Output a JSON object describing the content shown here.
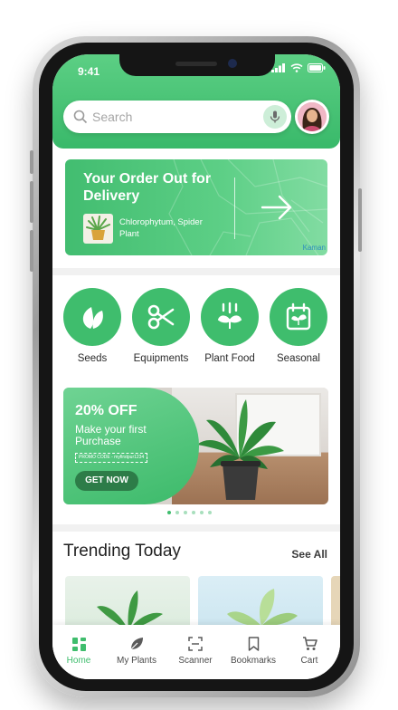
{
  "status_bar": {
    "time": "9:41"
  },
  "search": {
    "placeholder": "Search"
  },
  "delivery": {
    "title": "Your Order Out for Delivery",
    "product": "Chlorophytum, Spider Plant",
    "map_label": "Kaman"
  },
  "categories": [
    {
      "label": "Seeds",
      "icon": "leaf-icon"
    },
    {
      "label": "Equipments",
      "icon": "scissors-icon"
    },
    {
      "label": "Plant Food",
      "icon": "plant-food-icon"
    },
    {
      "label": "Seasonal",
      "icon": "calendar-plant-icon"
    }
  ],
  "promo": {
    "discount": "20% OFF",
    "text": "Make your first Purchase",
    "code": "PROMO CODE - myfirstpur1234",
    "cta": "GET NOW",
    "dots_total": 6,
    "dots_active": 1
  },
  "trending": {
    "title": "Trending Today",
    "see_all": "See All"
  },
  "nav": [
    {
      "label": "Home",
      "icon": "home-icon",
      "active": true
    },
    {
      "label": "My Plants",
      "icon": "leaf-icon",
      "active": false
    },
    {
      "label": "Scanner",
      "icon": "scanner-icon",
      "active": false
    },
    {
      "label": "Bookmarks",
      "icon": "bookmark-icon",
      "active": false
    },
    {
      "label": "Cart",
      "icon": "cart-icon",
      "active": false
    }
  ],
  "colors": {
    "brand_green": "#3fbd6d",
    "dark_green": "#2d7c48"
  }
}
